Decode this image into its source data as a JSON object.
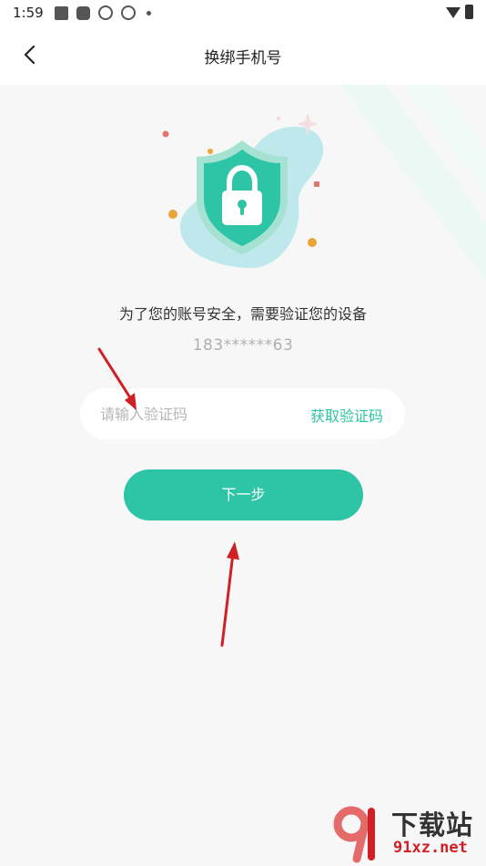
{
  "status_bar": {
    "time": "1:59"
  },
  "nav": {
    "title": "换绑手机号",
    "back_icon": "chevron-left-icon"
  },
  "illustration": {
    "icon": "shield-lock-icon"
  },
  "content": {
    "info_text": "为了您的账号安全，需要验证您的设备",
    "masked_phone": "183******63",
    "code_placeholder": "请输入验证码",
    "code_value": "",
    "get_code_label": "获取验证码",
    "next_label": "下一步"
  },
  "watermark": {
    "title": "下载站",
    "url": "91xz.net"
  },
  "colors": {
    "accent": "#2ec4a6",
    "background": "#f7f7f7",
    "annotation_arrow": "#d11f26"
  }
}
